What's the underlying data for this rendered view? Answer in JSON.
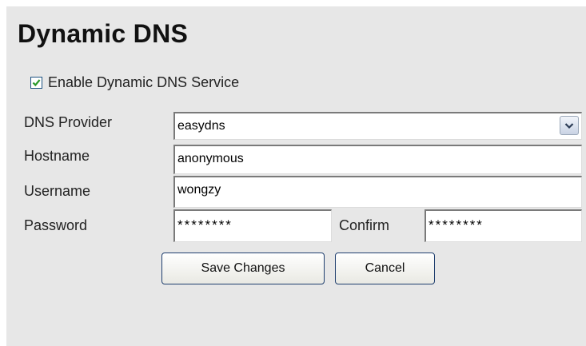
{
  "page": {
    "title": "Dynamic DNS"
  },
  "enable_service": {
    "label": "Enable Dynamic DNS Service",
    "checked": true
  },
  "form": {
    "provider": {
      "label": "DNS Provider",
      "value": "easydns"
    },
    "hostname": {
      "label": "Hostname",
      "value": "anonymous"
    },
    "username": {
      "label": "Username",
      "value": "wongzy"
    },
    "password": {
      "label": "Password",
      "value": "********"
    },
    "confirm": {
      "label": "Confirm",
      "value": "********"
    }
  },
  "buttons": {
    "save": "Save Changes",
    "cancel": "Cancel"
  },
  "icons": {
    "checkbox": "checkmark-icon",
    "dropdown": "chevron-down-icon"
  },
  "colors": {
    "panel_background": "#e7e7e7",
    "check_green": "#2a9a2a",
    "button_border": "#1f3e6e"
  }
}
